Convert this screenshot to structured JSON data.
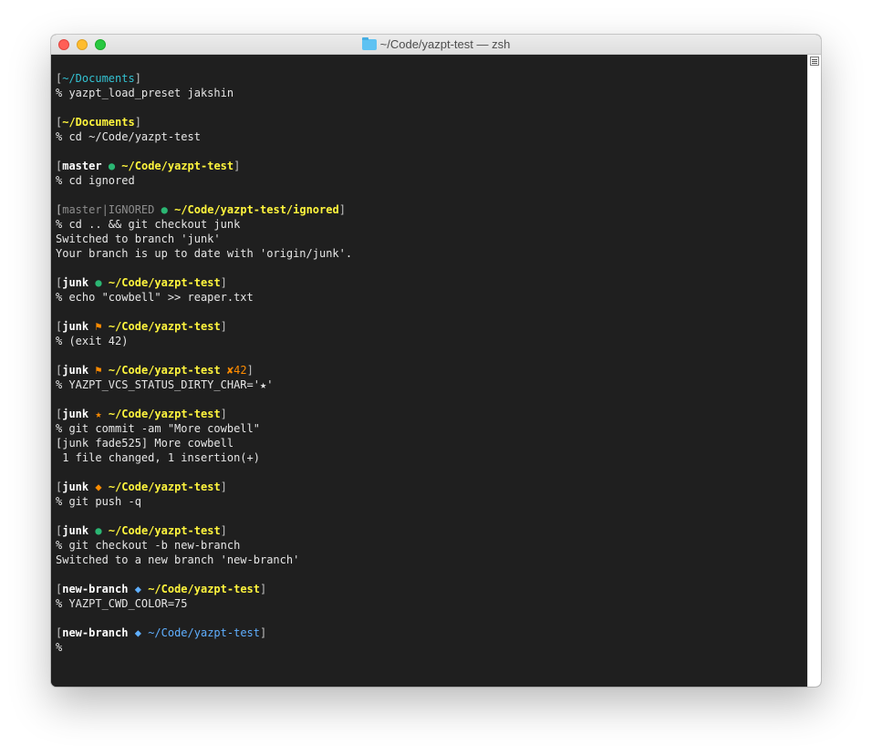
{
  "window": {
    "title": "~/Code/yazpt-test — zsh",
    "folder_icon": "folder-icon",
    "traffic_lights": [
      "close",
      "minimize",
      "maximize"
    ]
  },
  "colors": {
    "background": "#1f1f1f",
    "text": "#e6e6e6",
    "cwd_cyan": "#33c1d1",
    "cwd_yellow": "#fff53d",
    "cwd_blue": "#5fafff",
    "status_clean": "#2bb673",
    "status_dirty": "#ff8c00",
    "status_ignored": "#8d8d8d"
  },
  "terminal": {
    "lines": [
      [
        {
          "t": "[",
          "c": "c-bracket"
        },
        {
          "t": "~/Documents",
          "c": "c-cwd-cyan"
        },
        {
          "t": "]",
          "c": "c-bracket"
        }
      ],
      [
        {
          "t": "% yazpt_load_preset jakshin",
          "c": "c-text"
        }
      ],
      [],
      [
        {
          "t": "[",
          "c": "c-bracket"
        },
        {
          "t": "~/Documents",
          "c": "c-cwd-yellow"
        },
        {
          "t": "]",
          "c": "c-bracket"
        }
      ],
      [
        {
          "t": "% cd ~/Code/yazpt-test",
          "c": "c-text"
        }
      ],
      [],
      [
        {
          "t": "[",
          "c": "c-bracket"
        },
        {
          "t": "master",
          "c": "c-branch"
        },
        {
          "t": " ",
          "c": "c-text"
        },
        {
          "t": "●",
          "c": "c-green"
        },
        {
          "t": " ",
          "c": "c-text"
        },
        {
          "t": "~/Code/yazpt-test",
          "c": "c-cwd-yellow"
        },
        {
          "t": "]",
          "c": "c-bracket"
        }
      ],
      [
        {
          "t": "% cd ignored",
          "c": "c-text"
        }
      ],
      [],
      [
        {
          "t": "[",
          "c": "c-bracket"
        },
        {
          "t": "master|IGNORED",
          "c": "c-ignored"
        },
        {
          "t": " ",
          "c": "c-text"
        },
        {
          "t": "●",
          "c": "c-green"
        },
        {
          "t": " ",
          "c": "c-text"
        },
        {
          "t": "~/Code/yazpt-test/ignored",
          "c": "c-cwd-yellow"
        },
        {
          "t": "]",
          "c": "c-bracket"
        }
      ],
      [
        {
          "t": "% cd .. && git checkout junk",
          "c": "c-text"
        }
      ],
      [
        {
          "t": "Switched to branch 'junk'",
          "c": "c-text"
        }
      ],
      [
        {
          "t": "Your branch is up to date with 'origin/junk'.",
          "c": "c-text"
        }
      ],
      [],
      [
        {
          "t": "[",
          "c": "c-bracket"
        },
        {
          "t": "junk",
          "c": "c-branch"
        },
        {
          "t": " ",
          "c": "c-text"
        },
        {
          "t": "●",
          "c": "c-green"
        },
        {
          "t": " ",
          "c": "c-text"
        },
        {
          "t": "~/Code/yazpt-test",
          "c": "c-cwd-yellow"
        },
        {
          "t": "]",
          "c": "c-bracket"
        }
      ],
      [
        {
          "t": "% echo \"cowbell\" >> reaper.txt",
          "c": "c-text"
        }
      ],
      [],
      [
        {
          "t": "[",
          "c": "c-bracket"
        },
        {
          "t": "junk",
          "c": "c-branch"
        },
        {
          "t": " ",
          "c": "c-text"
        },
        {
          "t": "⚑",
          "c": "c-orange"
        },
        {
          "t": " ",
          "c": "c-text"
        },
        {
          "t": "~/Code/yazpt-test",
          "c": "c-cwd-yellow"
        },
        {
          "t": "]",
          "c": "c-bracket"
        }
      ],
      [
        {
          "t": "% (exit 42)",
          "c": "c-text"
        }
      ],
      [],
      [
        {
          "t": "[",
          "c": "c-bracket"
        },
        {
          "t": "junk",
          "c": "c-branch"
        },
        {
          "t": " ",
          "c": "c-text"
        },
        {
          "t": "⚑",
          "c": "c-orange"
        },
        {
          "t": " ",
          "c": "c-text"
        },
        {
          "t": "~/Code/yazpt-test",
          "c": "c-cwd-yellow"
        },
        {
          "t": " ",
          "c": "c-text"
        },
        {
          "t": "✘42",
          "c": "c-orange"
        },
        {
          "t": "]",
          "c": "c-bracket"
        }
      ],
      [
        {
          "t": "% YAZPT_VCS_STATUS_DIRTY_CHAR='★'",
          "c": "c-text"
        }
      ],
      [],
      [
        {
          "t": "[",
          "c": "c-bracket"
        },
        {
          "t": "junk",
          "c": "c-branch"
        },
        {
          "t": " ",
          "c": "c-text"
        },
        {
          "t": "★",
          "c": "c-orange"
        },
        {
          "t": " ",
          "c": "c-text"
        },
        {
          "t": "~/Code/yazpt-test",
          "c": "c-cwd-yellow"
        },
        {
          "t": "]",
          "c": "c-bracket"
        }
      ],
      [
        {
          "t": "% git commit -am \"More cowbell\"",
          "c": "c-text"
        }
      ],
      [
        {
          "t": "[junk fade525] More cowbell",
          "c": "c-text"
        }
      ],
      [
        {
          "t": " 1 file changed, 1 insertion(+)",
          "c": "c-text"
        }
      ],
      [],
      [
        {
          "t": "[",
          "c": "c-bracket"
        },
        {
          "t": "junk",
          "c": "c-branch"
        },
        {
          "t": " ",
          "c": "c-text"
        },
        {
          "t": "◆",
          "c": "c-orange"
        },
        {
          "t": " ",
          "c": "c-text"
        },
        {
          "t": "~/Code/yazpt-test",
          "c": "c-cwd-yellow"
        },
        {
          "t": "]",
          "c": "c-bracket"
        }
      ],
      [
        {
          "t": "% git push -q",
          "c": "c-text"
        }
      ],
      [],
      [
        {
          "t": "[",
          "c": "c-bracket"
        },
        {
          "t": "junk",
          "c": "c-branch"
        },
        {
          "t": " ",
          "c": "c-text"
        },
        {
          "t": "●",
          "c": "c-green"
        },
        {
          "t": " ",
          "c": "c-text"
        },
        {
          "t": "~/Code/yazpt-test",
          "c": "c-cwd-yellow"
        },
        {
          "t": "]",
          "c": "c-bracket"
        }
      ],
      [
        {
          "t": "% git checkout -b new-branch",
          "c": "c-text"
        }
      ],
      [
        {
          "t": "Switched to a new branch 'new-branch'",
          "c": "c-text"
        }
      ],
      [],
      [
        {
          "t": "[",
          "c": "c-bracket"
        },
        {
          "t": "new-branch",
          "c": "c-branch"
        },
        {
          "t": " ",
          "c": "c-text"
        },
        {
          "t": "◆",
          "c": "c-blue"
        },
        {
          "t": " ",
          "c": "c-text"
        },
        {
          "t": "~/Code/yazpt-test",
          "c": "c-cwd-yellow"
        },
        {
          "t": "]",
          "c": "c-bracket"
        }
      ],
      [
        {
          "t": "% YAZPT_CWD_COLOR=75",
          "c": "c-text"
        }
      ],
      [],
      [
        {
          "t": "[",
          "c": "c-bracket"
        },
        {
          "t": "new-branch",
          "c": "c-branch"
        },
        {
          "t": " ",
          "c": "c-text"
        },
        {
          "t": "◆",
          "c": "c-blue"
        },
        {
          "t": " ",
          "c": "c-text"
        },
        {
          "t": "~/Code/yazpt-test",
          "c": "c-cwd-blue"
        },
        {
          "t": "]",
          "c": "c-bracket"
        }
      ],
      [
        {
          "t": "%",
          "c": "c-text"
        }
      ]
    ]
  }
}
